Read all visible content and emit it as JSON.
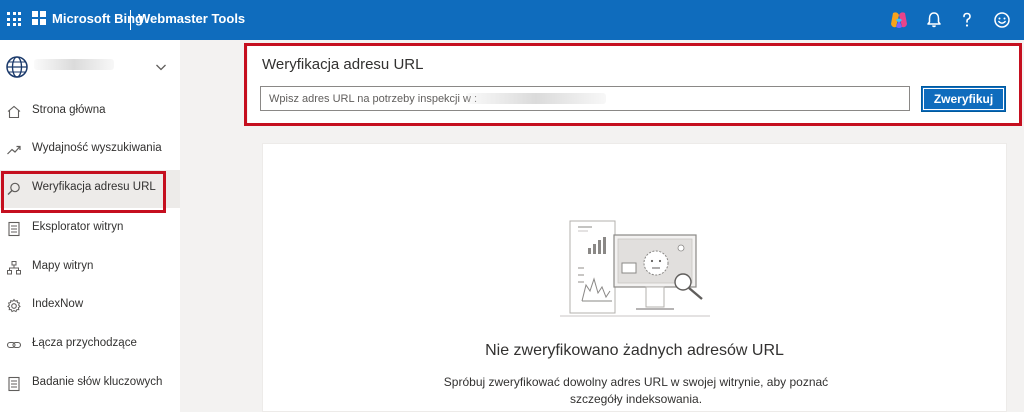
{
  "topbar": {
    "brand": "Microsoft Bing",
    "product": "Webmaster Tools",
    "icons": [
      "apps-grid-icon",
      "microsoft-logo-icon",
      "copilot-icon",
      "bell-icon",
      "help-icon",
      "feedback-smiley-icon"
    ]
  },
  "sidebar": {
    "site_icon": "globe-icon",
    "items": [
      {
        "label": "Strona główna",
        "icon": "home-icon"
      },
      {
        "label": "Wydajność wyszukiwania",
        "icon": "trend-icon"
      },
      {
        "label": "Weryfikacja adresu URL",
        "icon": "search-icon",
        "active": true
      },
      {
        "label": "Eksplorator witryn",
        "icon": "document-icon"
      },
      {
        "label": "Mapy witryn",
        "icon": "sitemap-icon"
      },
      {
        "label": "IndexNow",
        "icon": "gear-icon"
      },
      {
        "label": "Łącza przychodzące",
        "icon": "link-icon"
      },
      {
        "label": "Badanie słów kluczowych",
        "icon": "document-icon"
      }
    ]
  },
  "url_check": {
    "title": "Weryfikacja adresu URL",
    "input_placeholder": "Wpisz adres URL na potrzeby inspekcji w :",
    "input_value": "",
    "button_label": "Zweryfikuj"
  },
  "empty_state": {
    "title": "Nie zweryfikowano żadnych adresów URL",
    "description": "Spróbuj zweryfikować dowolny adres URL w swojej witrynie, aby poznać szczegóły indeksowania."
  },
  "colors": {
    "topbar": "#0f6cbd",
    "accent": "#0f6cbd",
    "highlight": "#c50f1f",
    "background": "#f3f2f1"
  }
}
